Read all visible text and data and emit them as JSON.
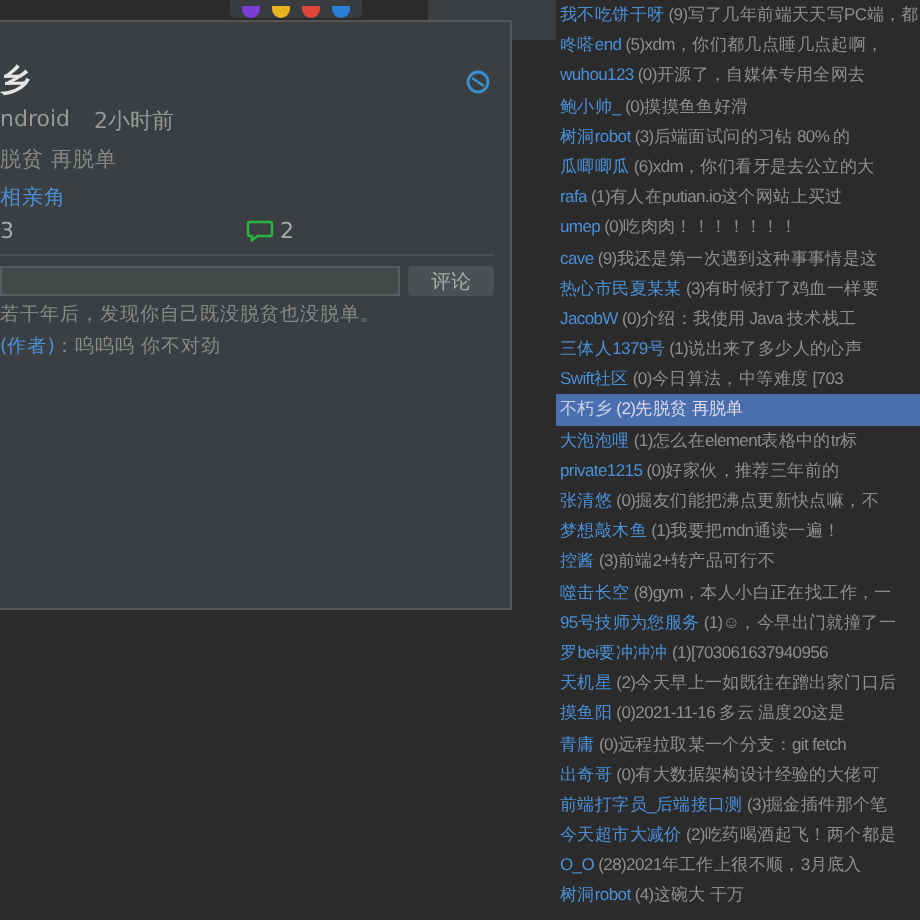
{
  "post": {
    "author": "乡",
    "device": "ndroid",
    "time": "2小时前",
    "content": "脱贫 再脱单",
    "topic": "相亲角",
    "likes": "3",
    "comments": "2"
  },
  "comment_box": {
    "button": "评论"
  },
  "comments": [
    {
      "text": "若干年后，发现你自己既没脱贫也没脱单。"
    },
    {
      "author": "(作者)",
      "text": "：呜呜呜 你不对劲"
    }
  ],
  "feed": [
    {
      "name": "我不吃饼干呀",
      "text": "(9)写了几年前端天天写PC端，都",
      "selected": false
    },
    {
      "name": "咚嗒end",
      "text": "(5)xdm，你们都几点睡几点起啊，",
      "selected": false
    },
    {
      "name": "wuhou123",
      "text": "(0)开源了，自媒体专用全网去",
      "selected": false
    },
    {
      "name": "鲍小帅_",
      "text": "(0)摸摸鱼鱼好滑",
      "selected": false
    },
    {
      "name": "树洞robot",
      "text": "(3)后端面试问的习钻 80% 的",
      "selected": false
    },
    {
      "name": "瓜唧唧瓜",
      "text": "(6)xdm，你们看牙是去公立的大",
      "selected": false
    },
    {
      "name": "rafa",
      "text": "(1)有人在putian.io这个网站上买过",
      "selected": false
    },
    {
      "name": "umep",
      "text": "(0)吃肉肉！！！！！！！",
      "selected": false
    },
    {
      "name": "cave",
      "text": "(9)我还是第一次遇到这种事事情是这",
      "selected": false
    },
    {
      "name": "热心市民夏某某",
      "text": "(3)有时候打了鸡血一样要",
      "selected": false
    },
    {
      "name": "JacobW",
      "text": "(0)介绍：我使用 Java 技术栈工",
      "selected": false
    },
    {
      "name": "三体人1379号",
      "text": "(1)说出来了多少人的心声",
      "selected": false
    },
    {
      "name": "Swift社区",
      "text": "(0)今日算法，中等难度 [703",
      "selected": false
    },
    {
      "name": "不朽乡",
      "text": "(2)先脱贫 再脱单",
      "selected": true
    },
    {
      "name": "大泡泡哩",
      "text": "(1)怎么在element表格中的tr标",
      "selected": false
    },
    {
      "name": "private1215",
      "text": "(0)好家伙，推荐三年前的",
      "selected": false
    },
    {
      "name": "张清悠",
      "text": "(0)掘友们能把沸点更新快点嘛，不",
      "selected": false
    },
    {
      "name": "梦想敲木鱼",
      "text": "(1)我要把mdn通读一遍！",
      "selected": false
    },
    {
      "name": "控酱",
      "text": "(3)前端2+转产品可行不",
      "selected": false
    },
    {
      "name": "噬击长空",
      "text": "(8)gym，本人小白正在找工作，一",
      "selected": false
    },
    {
      "name": "95号技师为您服务",
      "text": "(1)☺，今早出门就撞了一",
      "selected": false
    },
    {
      "name": "罗bei要冲冲冲",
      "text": "(1)[703061637940956",
      "selected": false
    },
    {
      "name": "天机星",
      "text": "(2)今天早上一如既往在蹭出家门口后",
      "selected": false
    },
    {
      "name": "摸鱼阳",
      "text": "(0)2021-11-16 多云 温度20这是",
      "selected": false
    },
    {
      "name": "青庸",
      "text": "(0)远程拉取某一个分支：git fetch",
      "selected": false
    },
    {
      "name": "出奇哥",
      "text": "(0)有大数据架构设计经验的大佬可",
      "selected": false
    },
    {
      "name": "前端打字员_后端接口测",
      "text": "(3)掘金插件那个笔",
      "selected": false
    },
    {
      "name": "今天超市大减价",
      "text": "(2)吃药喝酒起飞！两个都是",
      "selected": false
    },
    {
      "name": "O_O",
      "text": "(28)2021年工作上很不顺，3月底入",
      "selected": false
    },
    {
      "name": "树洞robot",
      "text": "(4)这碗大 干万",
      "selected": false
    }
  ]
}
